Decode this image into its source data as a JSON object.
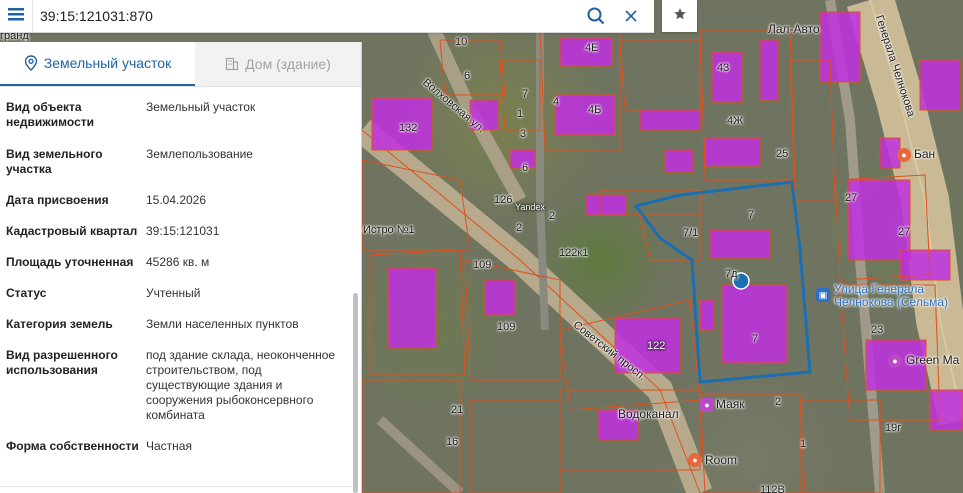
{
  "search": {
    "query": "39:15:121031:870"
  },
  "tabs": [
    {
      "label": "Земельный участок",
      "active": true
    },
    {
      "label": "Дом (здание)",
      "active": false
    }
  ],
  "details": [
    {
      "key": "Вид объекта недвижимости",
      "value": "Земельный участок"
    },
    {
      "key": "Вид земельного участка",
      "value": "Землепользование"
    },
    {
      "key": "Дата присвоения",
      "value": "15.04.2026"
    },
    {
      "key": "Кадастровый квартал",
      "value": "39:15:121031"
    },
    {
      "key": "Площадь уточненная",
      "value": "45286 кв. м"
    },
    {
      "key": "Статус",
      "value": "Учтенный"
    },
    {
      "key": "Категория земель",
      "value": "Земли населенных пунктов"
    },
    {
      "key": "Вид разрешенного использования",
      "value": "под здание склада, неоконченное строительством, под существующие здания и сооружения рыбоконсервного комбината"
    },
    {
      "key": "Форма собственности",
      "value": "Частная"
    }
  ],
  "map": {
    "parcel_labels": [
      "10",
      "6",
      "7",
      "1",
      "3",
      "4Е",
      "4Б",
      "4",
      "43",
      "4Ж",
      "25",
      "6",
      "2",
      "132",
      "126",
      "2",
      "122к1",
      "7/1",
      "7",
      "7д",
      "7",
      "109",
      "109",
      "122",
      "27",
      "27",
      "23",
      "21",
      "16",
      "1",
      "2",
      "112В",
      "19г"
    ],
    "street_labels": [
      "Волховская ул.",
      "Советский просп.",
      "Генерала Челнокова",
      "гранд",
      "Истро №1"
    ],
    "poi_labels": [
      "Лал-Авто",
      "Бан",
      "Улица Генерала Челнокова (Сельма)",
      "Green Ma",
      "Водоканал",
      "Маяк",
      "Room",
      "Yandex"
    ]
  },
  "colors": {
    "accent": "#1c63a6",
    "parcel_fill": "#c030e0",
    "parcel_border": "#e0501e",
    "selection": "#1b6fb0"
  }
}
